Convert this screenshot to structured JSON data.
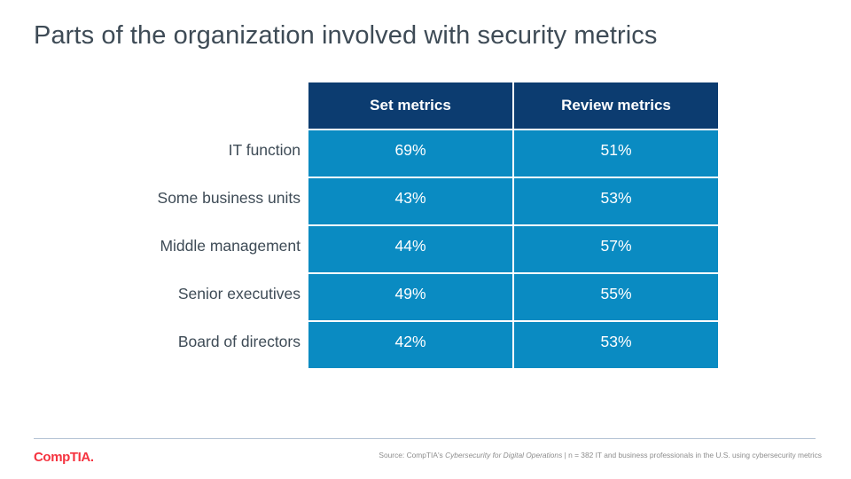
{
  "slide": {
    "title": "Parts of the organization involved with security metrics",
    "title_color": "#3e4b56",
    "background": "#ffffff"
  },
  "table": {
    "header_bg": "#0c3c70",
    "cell_bg": "#0a8bc2",
    "gap_color": "#ffffff",
    "row_label_header": "",
    "columns": [
      "Set metrics",
      "Review metrics"
    ],
    "rows": [
      {
        "label": "IT function",
        "set": "69%",
        "review": "51%"
      },
      {
        "label": "Some business units",
        "set": "43%",
        "review": "53%"
      },
      {
        "label": "Middle management",
        "set": "44%",
        "review": "57%"
      },
      {
        "label": "Senior executives",
        "set": "49%",
        "review": "55%"
      },
      {
        "label": "Board of directors",
        "set": "42%",
        "review": "53%"
      }
    ]
  },
  "chart_data": {
    "type": "table",
    "title": "Parts of the organization involved with security metrics",
    "categories": [
      "IT function",
      "Some business units",
      "Middle management",
      "Senior executives",
      "Board of directors"
    ],
    "series": [
      {
        "name": "Set metrics",
        "values": [
          69,
          43,
          44,
          49,
          42
        ]
      },
      {
        "name": "Review metrics",
        "values": [
          51,
          53,
          57,
          55,
          53
        ]
      }
    ],
    "value_suffix": "%",
    "xlabel": "",
    "ylabel": "",
    "legend_position": "top",
    "grid": false
  },
  "footer": {
    "logo_text": "CompTIA",
    "logo_dot": ".",
    "logo_color": "#f5333f",
    "divider_color": "#b3c2d4",
    "source_prefix": "Source: CompTIA's ",
    "source_italic": "Cybersecurity for Digital Operations",
    "source_suffix": " | n = 382 IT and business professionals in the U.S. using cybersecurity metrics"
  }
}
